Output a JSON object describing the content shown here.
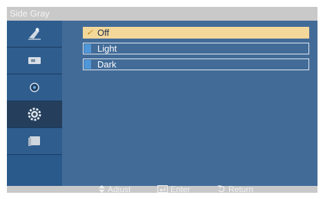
{
  "window": {
    "title": "Side Gray"
  },
  "sidebar": {
    "items": [
      {
        "icon": "picture-icon",
        "active": false
      },
      {
        "icon": "sound-icon",
        "active": false
      },
      {
        "icon": "setup-icon",
        "active": false
      },
      {
        "icon": "gear-icon",
        "active": true
      },
      {
        "icon": "multi-control-icon",
        "active": false
      }
    ]
  },
  "options": [
    {
      "label": "Off",
      "selected": true,
      "check": "✓"
    },
    {
      "label": "Light",
      "selected": false
    },
    {
      "label": "Dark",
      "selected": false
    }
  ],
  "footer": {
    "adjust_label": "Adjust",
    "enter_label": "Enter",
    "return_label": "Return"
  },
  "colors": {
    "selected_bg": "#f4d89a",
    "panel_bg": "#426b98",
    "title_bar": "#c9c9c9"
  }
}
